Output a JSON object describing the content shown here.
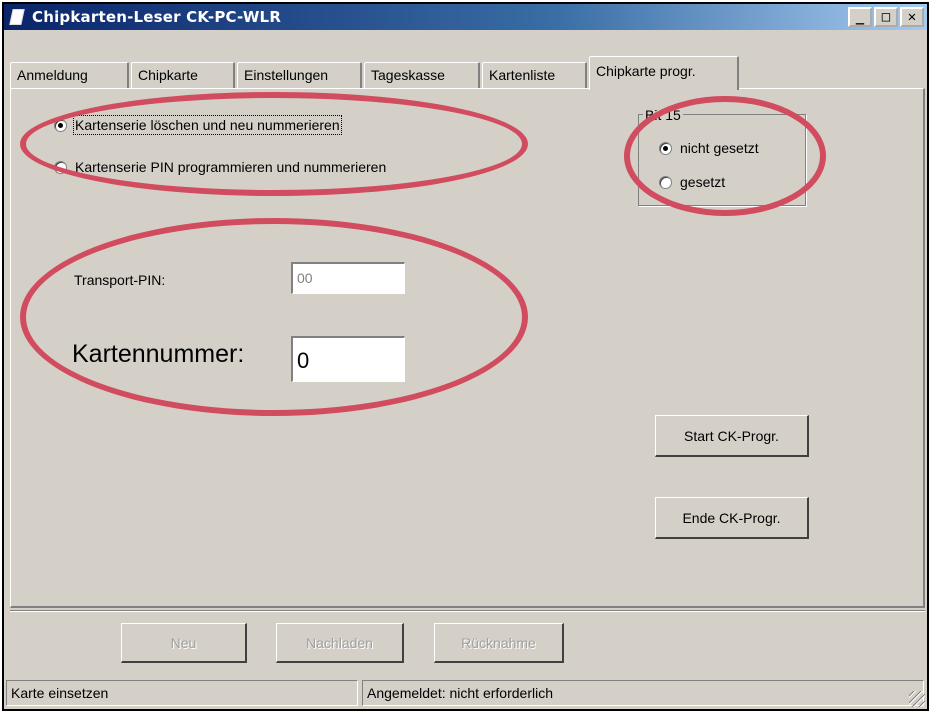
{
  "window": {
    "title": "Chipkarten-Leser CK-PC-WLR",
    "controls": {
      "minimize": "_",
      "maximize": "□",
      "close": "✕"
    }
  },
  "tabs": [
    {
      "label": "Anmeldung",
      "active": false
    },
    {
      "label": "Chipkarte",
      "active": false
    },
    {
      "label": "Einstellungen",
      "active": false
    },
    {
      "label": "Tageskasse",
      "active": false
    },
    {
      "label": "Kartenliste",
      "active": false
    },
    {
      "label": "Chipkarte progr.",
      "active": true
    }
  ],
  "mode": {
    "options": [
      {
        "label": "Kartenserie löschen und neu nummerieren",
        "checked": true
      },
      {
        "label": "Kartenserie PIN programmieren und nummerieren",
        "checked": false
      }
    ]
  },
  "bit15": {
    "legend": "Bit 15",
    "options": [
      {
        "label": "nicht gesetzt",
        "checked": true
      },
      {
        "label": "gesetzt",
        "checked": false
      }
    ]
  },
  "transport_pin": {
    "label": "Transport-PIN:",
    "value": "00"
  },
  "kartennummer": {
    "label": "Kartennummer:",
    "value": "0"
  },
  "buttons": {
    "start": "Start CK-Progr.",
    "ende": "Ende CK-Progr.",
    "neu": "Neu",
    "nachladen": "Nachladen",
    "ruecknahme": "Rücknahme"
  },
  "status": {
    "left": "Karte einsetzen",
    "right": "Angemeldet: nicht erforderlich"
  },
  "colors": {
    "window_bg": "#d4d0c8",
    "annotation_red": "#d04c5e",
    "title_gradient_start": "#0a246a"
  },
  "icons": [
    "app-icon",
    "minimize-icon",
    "maximize-icon",
    "close-icon",
    "resize-grip-icon"
  ]
}
